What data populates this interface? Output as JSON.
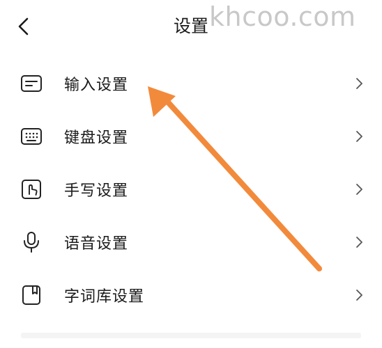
{
  "header": {
    "title": "设置",
    "back_icon": "chevron-left-icon"
  },
  "watermark": "khcoo.com",
  "menu": {
    "items": [
      {
        "label": "输入设置",
        "icon": "input-icon"
      },
      {
        "label": "键盘设置",
        "icon": "keyboard-icon"
      },
      {
        "label": "手写设置",
        "icon": "handwriting-icon"
      },
      {
        "label": "语音设置",
        "icon": "microphone-icon"
      },
      {
        "label": "字词库设置",
        "icon": "dictionary-icon"
      }
    ]
  },
  "annotation": {
    "color": "#f28a3c"
  }
}
